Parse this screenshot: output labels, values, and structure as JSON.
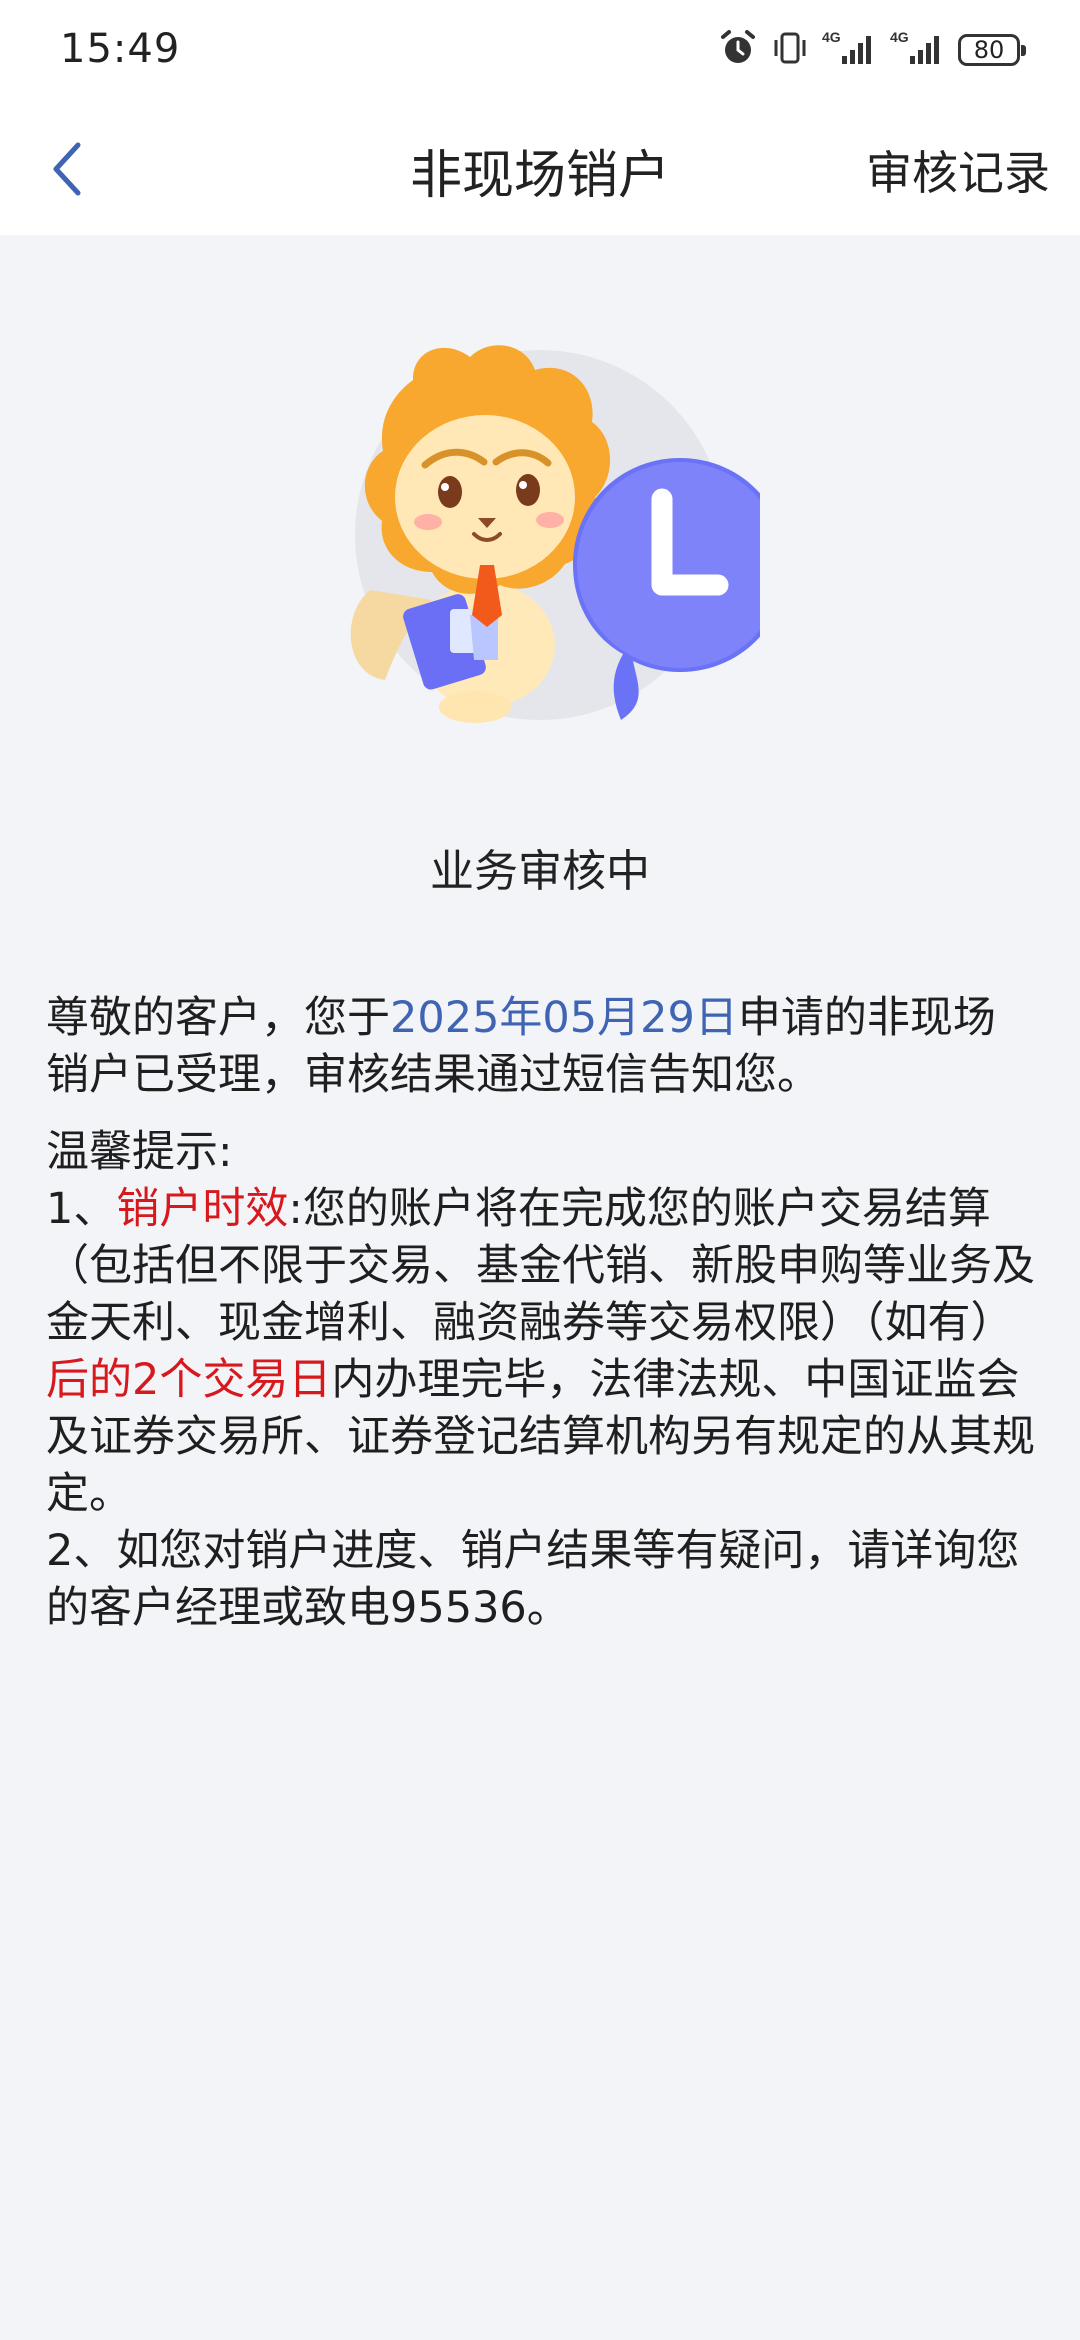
{
  "status_bar": {
    "time": "15:49",
    "battery": "80",
    "network_1": "4G",
    "network_2": "4G",
    "icons": [
      "alarm-icon",
      "vibrate-icon",
      "signal-4g-icon",
      "signal-4g-icon",
      "battery-icon"
    ]
  },
  "nav": {
    "back_icon": "chevron-left-icon",
    "title": "非现场销户",
    "right_action": "审核记录"
  },
  "illustration": {
    "name": "lion-mascot-clock-illustration"
  },
  "status": {
    "text": "业务审核中"
  },
  "notice": {
    "greeting_prefix": "尊敬的客户，您于",
    "date": "2025年05月29日",
    "greeting_suffix": "申请的非现场销户已受理，审核结果通过短信告知您。",
    "tips_title": "温馨提示:",
    "tip1_prefix": "1、",
    "tip1_highlight_label": "销户时效",
    "tip1_mid": ":您的账户将在完成您的账户交易结算（包括但不限于交易、基金代销、新股申购等业务及金天利、现金增利、融资融券等交易权限）（如有）",
    "tip1_highlight_days": "后的2个交易日",
    "tip1_suffix": "内办理完毕，法律法规、中国证监会及证券交易所、证券登记结算机构另有规定的从其规定。",
    "tip2": "2、如您对销户进度、销户结果等有疑问，请详询您的客户经理或致电95536。"
  },
  "colors": {
    "background": "#f3f4f7",
    "accent_blue": "#3f64b4",
    "highlight_red": "#d7191d"
  }
}
